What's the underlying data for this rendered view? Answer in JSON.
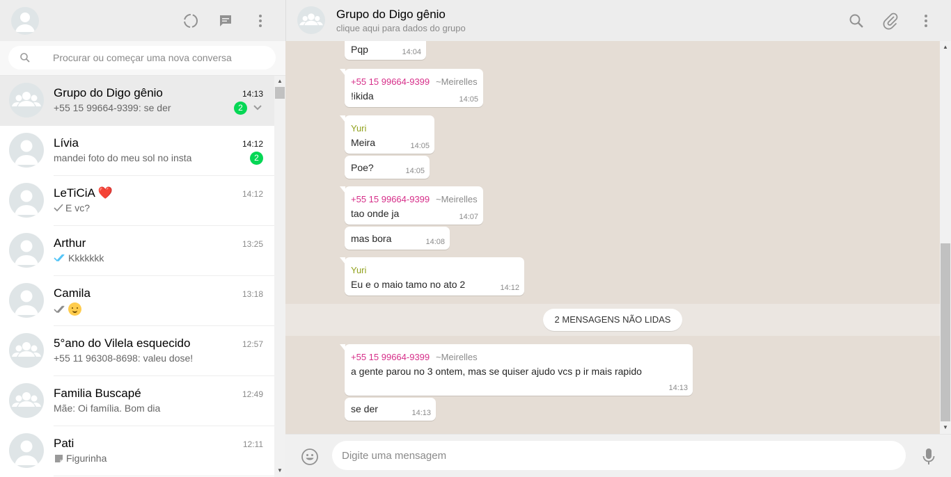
{
  "left_header": {
    "icons": [
      "status-icon",
      "new-chat-icon",
      "menu-icon"
    ]
  },
  "search": {
    "placeholder": "Procurar ou começar uma nova conversa"
  },
  "chats": [
    {
      "name": "Grupo do Digo gênio",
      "time": "14:13",
      "preview": "+55 15 99664-9399: se der",
      "unread": "2",
      "type": "group",
      "active": true
    },
    {
      "name": "Lívia",
      "time": "14:12",
      "preview": "mandei foto do meu sol no insta",
      "unread": "2",
      "type": "user"
    },
    {
      "name": "LeTiCiA",
      "name_emoji": "❤️",
      "time": "14:12",
      "preview": "E vc?",
      "tick": "single-check",
      "type": "user"
    },
    {
      "name": "Arthur",
      "time": "13:25",
      "preview": "Kkkkkkk",
      "tick": "double-check-blue",
      "type": "user"
    },
    {
      "name": "Camila",
      "time": "13:18",
      "preview_emoji": "hugging-face",
      "tick": "double-check-gray",
      "type": "user"
    },
    {
      "name": "5°ano do Vilela esquecido",
      "time": "12:57",
      "preview": "+55 11 96308-8698: valeu dose!",
      "type": "group"
    },
    {
      "name": "Familia Buscapé",
      "time": "12:49",
      "preview": "Mãe: Oi família. Bom dia",
      "type": "group"
    },
    {
      "name": "Pati",
      "time": "12:11",
      "preview": "Figurinha",
      "preview_icon": "sticker-icon",
      "type": "user"
    }
  ],
  "conversation": {
    "title": "Grupo do Digo gênio",
    "subtitle": "clique aqui para dados do grupo",
    "header_icons": [
      "search-icon",
      "attach-icon",
      "menu-icon"
    ],
    "messages": [
      {
        "text": "Pqp",
        "time": "14:04"
      },
      {
        "sender": "+55 15 99664-9399",
        "pushname": "~Meirelles",
        "text": "!ikida",
        "time": "14:05"
      },
      {
        "sender": "Yuri",
        "text": "Meira",
        "time": "14:05"
      },
      {
        "text": "Poe?",
        "time": "14:05"
      },
      {
        "sender": "+55 15 99664-9399",
        "pushname": "~Meirelles",
        "text": "tao onde ja",
        "time": "14:07"
      },
      {
        "text": "mas bora",
        "time": "14:08"
      },
      {
        "sender": "Yuri",
        "text": "Eu e o maio tamo no ato 2",
        "time": "14:12"
      },
      {
        "sender": "+55 15 99664-9399",
        "pushname": "~Meirelles",
        "text": "a gente parou no 3 ontem, mas se quiser ajudo vcs p ir mais rapido",
        "time": "14:13"
      },
      {
        "text": "se der",
        "time": "14:13"
      }
    ],
    "unread_banner": "2 MENSAGENS NÃO LIDAS",
    "colors": {
      "sender_phone": "#d62e89",
      "sender_yuri": "#92a21f",
      "badge": "#06d755",
      "wallpaper": "#e5ddd5"
    }
  },
  "composer": {
    "placeholder": "Digite uma mensagem"
  }
}
